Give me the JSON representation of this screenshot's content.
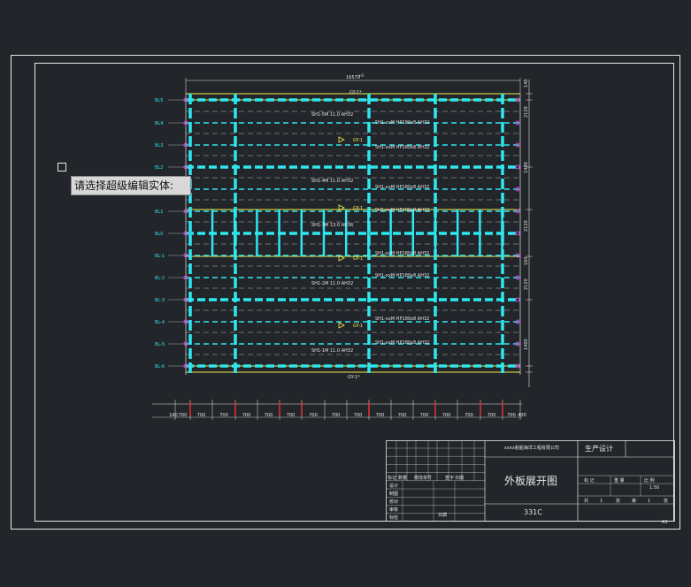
{
  "command_prompt": "请选择超级编辑实体:",
  "drawing": {
    "overall_dimension": "16570",
    "overall_dimension_sup": "+0",
    "frame_labels_top": [
      "GY-1*"
    ],
    "frame_labels_bottom": [
      "GY-1*"
    ],
    "row_labels": [
      "BL5",
      "BL4",
      "BL3",
      "BL2",
      "BL1",
      "BL0",
      "BL-1",
      "BL-2",
      "BL-3",
      "BL-4",
      "BL-5",
      "BL-6"
    ],
    "plate_notes": [
      "SH1-5M 11.0 AH32",
      "SH1-4M 11.0 AH32",
      "SH1-3M 13.0 AH36",
      "SH1-2M 11.0 AH32",
      "SH1-1M 11.0 AH32"
    ],
    "profile_note": "SH1-xxM HP180x8 AH32",
    "gy_labels": [
      "GY-1",
      "GY-1",
      "GY-1",
      "GY-1"
    ],
    "right_dims": [
      "140",
      "2120",
      "1480",
      "2120",
      "160",
      "2120",
      "1400"
    ],
    "bottom_dims": [
      "140",
      "700",
      "700",
      "700",
      "700",
      "700",
      "700",
      "700",
      "700",
      "700",
      "700",
      "700",
      "700",
      "700",
      "700",
      "700",
      "700",
      "400"
    ]
  },
  "title_block": {
    "company_small": "xxxx船舶海洋工程有限公司",
    "stage": "生产设计",
    "drawing_title": "外板展开图",
    "drawing_number": "331C",
    "scale_header": [
      "标  记",
      "重  量",
      "比  例"
    ],
    "scale_value": "1:50",
    "sheet_row": [
      "共",
      "1",
      "张",
      "第",
      "1",
      "张"
    ],
    "revision_headers": [
      "标记",
      "数量",
      "修改单号",
      "签字",
      "日期"
    ],
    "role_labels": [
      "设计",
      "制图",
      "校对",
      "审核",
      "标检"
    ],
    "date_label": "日期",
    "paper_size": "A3"
  },
  "colors": {
    "background": "#222529",
    "frame": "#e6e6e6",
    "cyan": "#2ee8f0",
    "yellow": "#f4f050",
    "magenta": "#e040e0",
    "red": "#e03030",
    "white_dim": "#d0d0d0"
  }
}
